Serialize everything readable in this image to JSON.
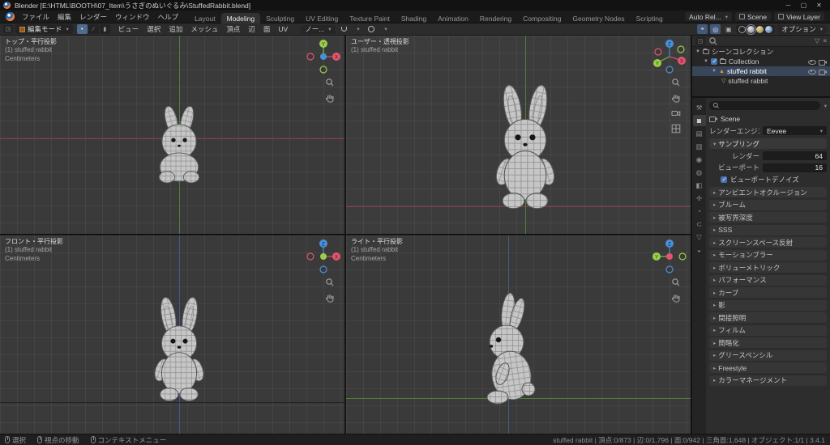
{
  "titlebar": {
    "title": "Blender [E:\\HTML\\BOOTH\\07_Item\\うさぎのぬいぐるみ\\StuffedRabbit.blend]"
  },
  "menubar": {
    "menus": [
      "ファイル",
      "編集",
      "レンダー",
      "ウィンドウ",
      "ヘルプ"
    ],
    "workspaces": [
      {
        "label": "Layout"
      },
      {
        "label": "Modeling",
        "active": true
      },
      {
        "label": "Sculpting"
      },
      {
        "label": "UV Editing"
      },
      {
        "label": "Texture Paint"
      },
      {
        "label": "Shading"
      },
      {
        "label": "Animation"
      },
      {
        "label": "Rendering"
      },
      {
        "label": "Compositing"
      },
      {
        "label": "Geometry Nodes"
      },
      {
        "label": "Scripting"
      }
    ],
    "auto_label": "Auto Rel...",
    "scene": "Scene",
    "view_layer": "View Layer"
  },
  "toolheader": {
    "mode": "編集モード",
    "menus": [
      "ビュー",
      "選択",
      "追加",
      "メッシュ",
      "頂点",
      "辺",
      "面",
      "UV"
    ],
    "orientation": "ノー...",
    "options": "オプション"
  },
  "viewports": [
    {
      "title": "トップ・平行投影",
      "object": "(1) stuffed rabbit",
      "units": "Centimeters"
    },
    {
      "title": "ユーザー・透視投影",
      "object": "(1) stuffed rabbit",
      "units": ""
    },
    {
      "title": "フロント・平行投影",
      "object": "(1) stuffed rabbit",
      "units": "Centimeters"
    },
    {
      "title": "ライト・平行投影",
      "object": "(1) stuffed rabbit",
      "units": "Centimeters"
    }
  ],
  "outliner": {
    "scene_collection": "シーンコレクション",
    "collection": "Collection",
    "object": "stuffed rabbit",
    "mesh": "stuffed rabbit"
  },
  "properties": {
    "breadcrumb": "Scene",
    "engine_label": "レンダーエンジン",
    "engine_value": "Eevee",
    "sampling_title": "サンプリング",
    "render_label": "レンダー",
    "render_value": "64",
    "viewport_label": "ビューポート",
    "viewport_value": "16",
    "denoise_label": "ビューポートデノイズ",
    "sections": [
      "アンビエントオクルージョン",
      "ブルーム",
      "被写界深度",
      "SSS",
      "スクリーンスペース反射",
      "モーションブラー",
      "ボリューメトリック",
      "パフォーマンス",
      "カーブ",
      "影",
      "間接照明",
      "フィルム",
      "簡略化",
      "グリースペンシル",
      "Freestyle",
      "カラーマネージメント"
    ]
  },
  "prop_tabs": [
    {
      "name": "tool",
      "glyph": "⚒"
    },
    {
      "name": "render",
      "glyph": "◙",
      "active": true
    },
    {
      "name": "output",
      "glyph": "▤"
    },
    {
      "name": "view-layer",
      "glyph": "▥"
    },
    {
      "name": "scene",
      "glyph": "◉"
    },
    {
      "name": "world",
      "glyph": "◍"
    },
    {
      "name": "object",
      "glyph": "◧"
    },
    {
      "name": "modifiers",
      "glyph": "✢"
    },
    {
      "name": "physics",
      "glyph": "◔"
    },
    {
      "name": "constraints",
      "glyph": "⊂"
    },
    {
      "name": "data",
      "glyph": "▽"
    },
    {
      "name": "material",
      "glyph": "◒"
    }
  ],
  "statusbar": {
    "hints": [
      "選択",
      "視点の移動",
      "コンテキストメニュー"
    ],
    "stats": "stuffed rabbit | 頂点:0/873 | 辺:0/1,796 | 面:0/942 | 三角面:1,648 | オブジェクト:1/1 | 3.4.1"
  },
  "colors": {
    "accent": "#4772b3",
    "axis_x": "#e3556f",
    "axis_y": "#9acd4a",
    "axis_z": "#4a90d9"
  }
}
